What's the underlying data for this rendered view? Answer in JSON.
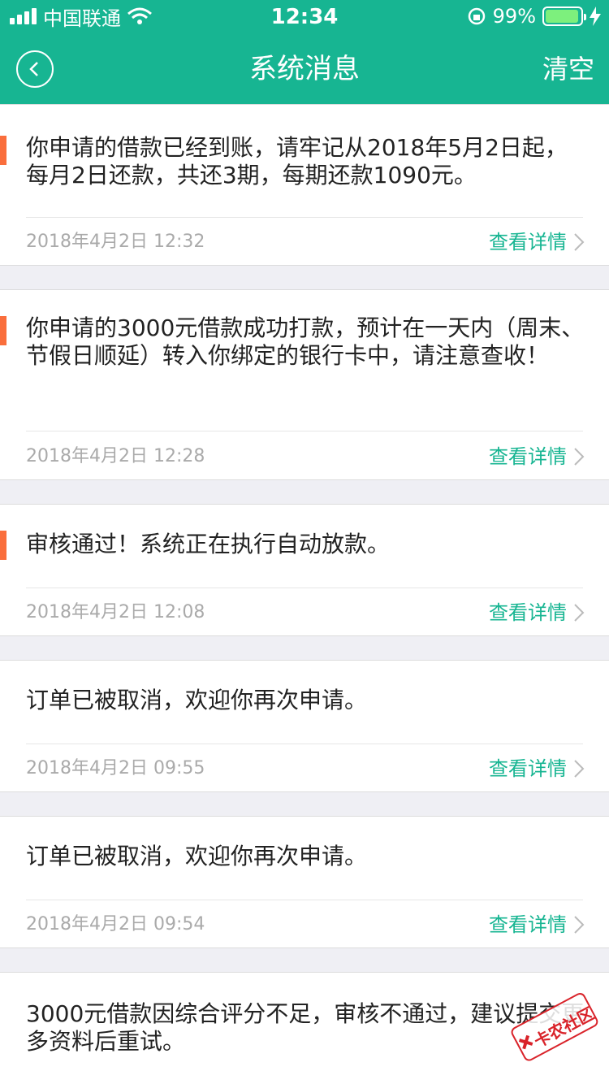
{
  "status_bar": {
    "carrier": "中国联通",
    "time": "12:34",
    "battery": "99%"
  },
  "nav": {
    "title": "系统消息",
    "clear_label": "清空"
  },
  "messages": [
    {
      "text": "你申请的借款已经到账，请牢记从2018年5月2日起，每月2日还款，共还3期，每期还款1090元。",
      "time": "2018年4月2日 12:32",
      "detail": "查看详情",
      "unread": true
    },
    {
      "text": "你申请的3000元借款成功打款，预计在一天内（周末、节假日顺延）转入你绑定的银行卡中，请注意查收！",
      "time": "2018年4月2日 12:28",
      "detail": "查看详情",
      "unread": true
    },
    {
      "text": "审核通过！系统正在执行自动放款。",
      "time": "2018年4月2日 12:08",
      "detail": "查看详情",
      "unread": true
    },
    {
      "text": "订单已被取消，欢迎你再次申请。",
      "time": "2018年4月2日 09:55",
      "detail": "查看详情",
      "unread": false
    },
    {
      "text": "订单已被取消，欢迎你再次申请。",
      "time": "2018年4月2日 09:54",
      "detail": "查看详情",
      "unread": false
    },
    {
      "text": "3000元借款因综合评分不足，审核不通过，建议提交更多资料后重试。",
      "time": "",
      "detail": "",
      "unread": false
    }
  ],
  "watermark": {
    "text": "卡农社区"
  },
  "colors": {
    "brand": "#17b592",
    "unread_marker": "#fa6e3c"
  }
}
